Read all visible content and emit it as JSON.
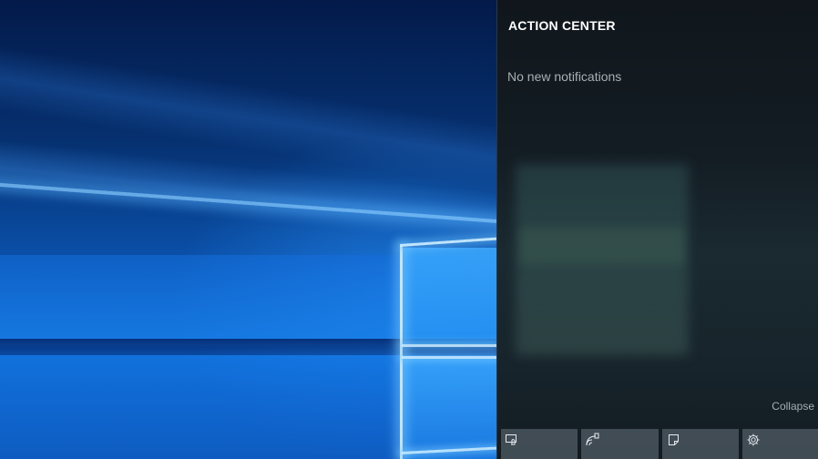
{
  "action_center": {
    "title": "ACTION CENTER",
    "empty_message": "No new notifications",
    "collapse_label": "Collapse",
    "quick_actions": [
      {
        "name": "tablet-mode",
        "icon": "tablet-mode-icon",
        "label": ""
      },
      {
        "name": "connect",
        "icon": "connect-icon",
        "label": ""
      },
      {
        "name": "note",
        "icon": "note-icon",
        "label": ""
      },
      {
        "name": "all-settings",
        "icon": "gear-icon",
        "label": ""
      }
    ]
  },
  "colors": {
    "panel_background": "#141d24",
    "title_text": "#ffffff",
    "secondary_text": "#a9b0b6",
    "tile_background": "#5a6670",
    "wallpaper_accent": "#0b5ec3"
  }
}
